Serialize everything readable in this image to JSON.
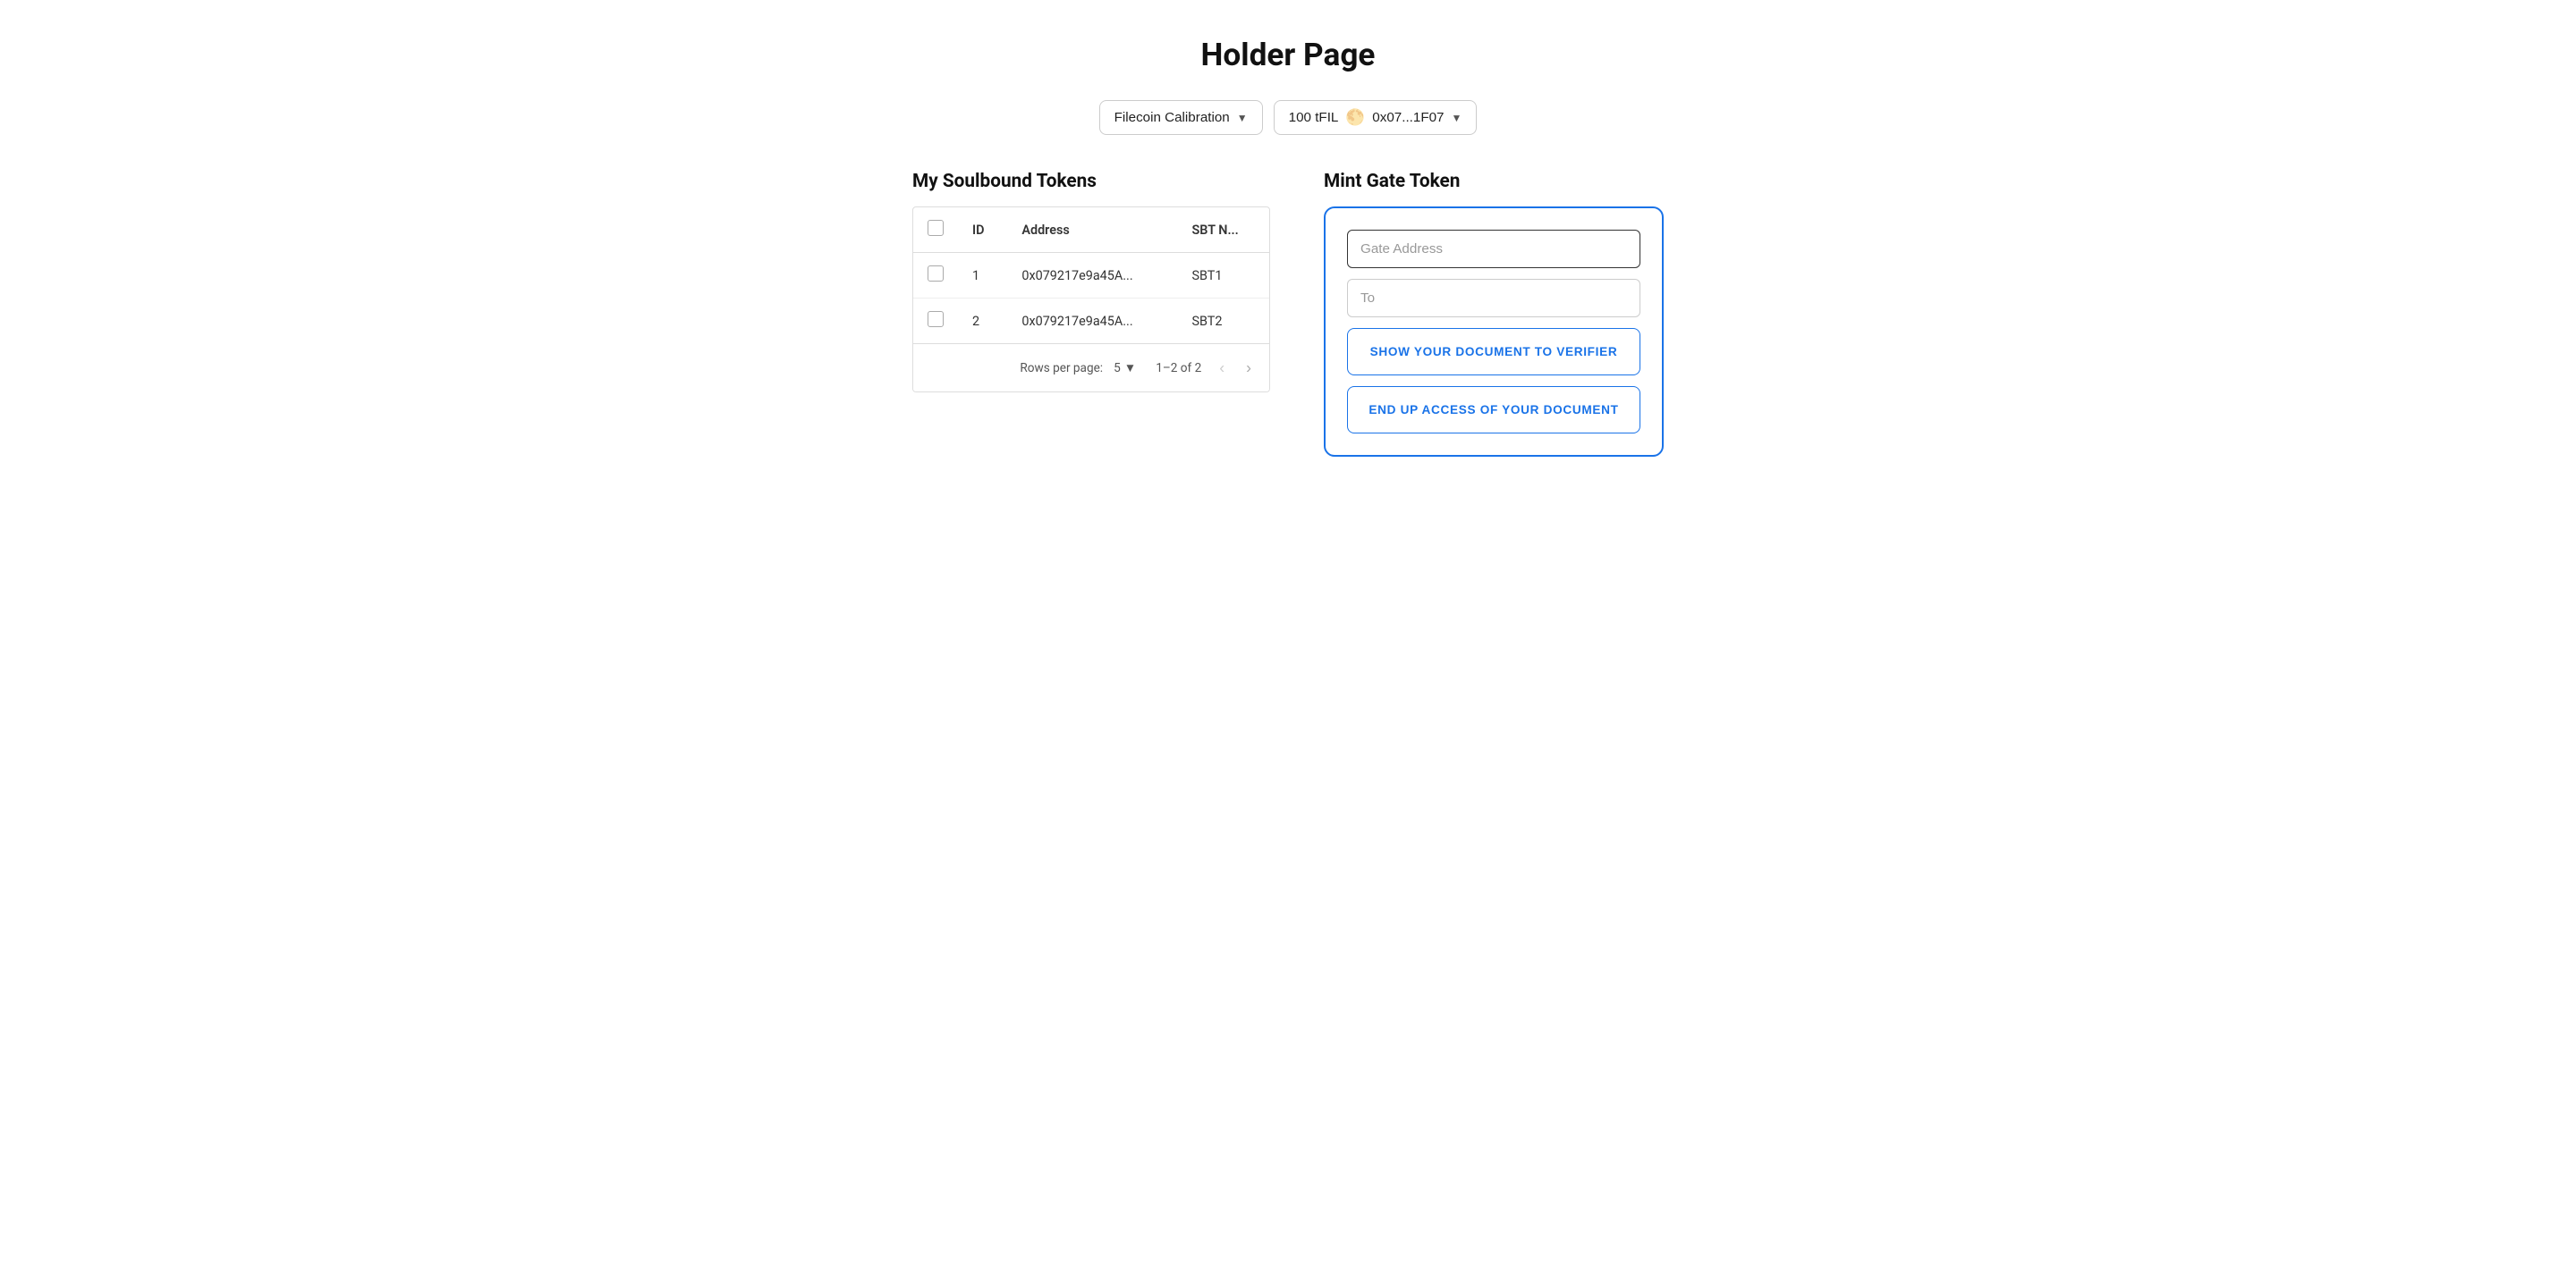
{
  "page": {
    "title": "Holder Page"
  },
  "header": {
    "network_label": "Filecoin Calibration",
    "balance_label": "100 tFIL",
    "wallet_emoji": "🌕",
    "wallet_address": "0x07...1F07"
  },
  "sbt_section": {
    "title": "My Soulbound Tokens",
    "table": {
      "columns": [
        "ID",
        "Address",
        "SBT N..."
      ],
      "rows": [
        {
          "id": "1",
          "address": "0x079217e9a45A...",
          "sbt": "SBT1"
        },
        {
          "id": "2",
          "address": "0x079217e9a45A...",
          "sbt": "SBT2"
        }
      ]
    },
    "footer": {
      "rows_per_page_label": "Rows per page:",
      "rows_per_page_value": "5",
      "pagination_info": "1–2 of 2"
    }
  },
  "mint_section": {
    "title": "Mint Gate Token",
    "gate_address_placeholder": "Gate Address",
    "to_placeholder": "To",
    "btn_show_document": "SHOW YOUR DOCUMENT TO VERIFIER",
    "btn_end_access": "END UP ACCESS OF YOUR DOCUMENT"
  }
}
